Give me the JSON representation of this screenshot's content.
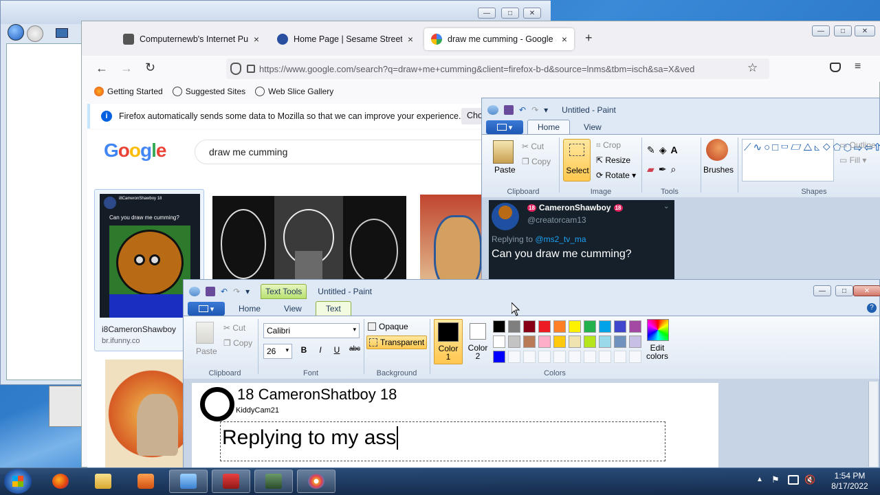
{
  "firefox": {
    "tabs": [
      {
        "label": "Computernewb's Internet Pub",
        "close": "×"
      },
      {
        "label": "Home Page | Sesame Street | PB",
        "close": "×"
      },
      {
        "label": "draw me cumming - Google Se",
        "close": "×"
      }
    ],
    "new_tab": "+",
    "url": "https://www.google.com/search?q=draw+me+cumming&client=firefox-b-d&source=lnms&tbm=isch&sa=X&ved",
    "bookmarks": [
      "Getting Started",
      "Suggested Sites",
      "Web Slice Gallery"
    ],
    "notification": "Firefox automatically sends some data to Mozilla so that we can improve your experience.",
    "notification_button": "Choo"
  },
  "google": {
    "logo": "Google",
    "query": "draw me cumming",
    "result1_title": "i8CameronShawboy",
    "result1_source": "br.ifunny.co",
    "thumb1_handle": "i8CameronShawboy 18",
    "thumb1_text": "Can you draw me cumming?"
  },
  "paint_back": {
    "title": "Untitled - Paint",
    "file_menu": "▾",
    "tabs": [
      "Home",
      "View"
    ],
    "clipboard": {
      "paste": "Paste",
      "cut": "Cut",
      "copy": "Copy",
      "label": "Clipboard"
    },
    "image": {
      "select": "Select",
      "crop": "Crop",
      "resize": "Resize",
      "rotate": "Rotate",
      "label": "Image"
    },
    "tools_label": "Tools",
    "brushes": "Brushes",
    "shapes": {
      "outline": "Outline",
      "fill": "Fill",
      "label": "Shapes"
    },
    "tweet": {
      "name": "CameronShawboy",
      "badge": "18",
      "handle": "@creatorcam13",
      "replying_prefix": "Replying to",
      "replying_to": "@ms2_tv_ma",
      "text": "Can you draw me cumming?"
    }
  },
  "paint_front": {
    "contextual": "Text Tools",
    "title": "Untitled - Paint",
    "tabs": [
      "Home",
      "View",
      "Text"
    ],
    "clipboard": {
      "paste": "Paste",
      "cut": "Cut",
      "copy": "Copy",
      "label": "Clipboard"
    },
    "font": {
      "family": "Calibri",
      "size": "26",
      "label": "Font",
      "bold": "B",
      "italic": "I",
      "underline": "U",
      "strike": "abc"
    },
    "background": {
      "opaque": "Opaque",
      "transparent": "Transparent",
      "label": "Background"
    },
    "color1": "Color 1",
    "color2": "Color 2",
    "edit_colors": "Edit colors",
    "colors_label": "Colors",
    "palette": [
      "#000000",
      "#7f7f7f",
      "#880015",
      "#ed1c24",
      "#ff7f27",
      "#fff200",
      "#22b14c",
      "#00a2e8",
      "#3f48cc",
      "#a349a4",
      "#ffffff",
      "#c3c3c3",
      "#b97a57",
      "#ffaec9",
      "#ffc90e",
      "#efe4b0",
      "#b5e61d",
      "#99d9ea",
      "#7092be",
      "#c8bfe7",
      "#0000ff",
      "#ffffff",
      "#ffffff",
      "#ffffff",
      "#ffffff",
      "#ffffff",
      "#ffffff",
      "#ffffff",
      "#ffffff",
      "#ffffff"
    ],
    "canvas": {
      "name_line": "18 CameronShatboy 18",
      "handle": "KiddyCam21",
      "typing": "Replying to my ass"
    }
  },
  "taskbar": {
    "time": "1:54 PM",
    "date": "8/17/2022"
  }
}
